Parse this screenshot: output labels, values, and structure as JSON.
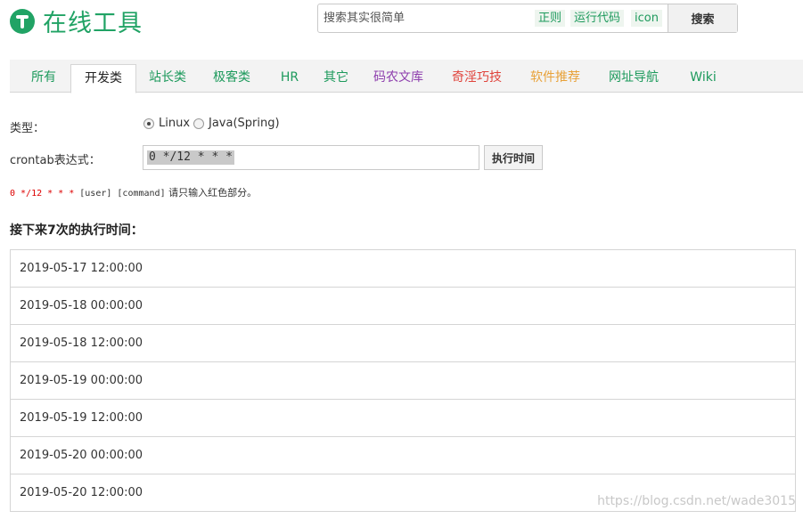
{
  "site": {
    "title": "在线工具"
  },
  "search": {
    "placeholder": "搜索其实很简单",
    "quick_links": [
      "正则",
      "运行代码",
      "icon"
    ],
    "button_label": "搜索"
  },
  "nav": {
    "active_index": 1,
    "items": [
      {
        "label": "所有",
        "color": "#1d9a5c"
      },
      {
        "label": "开发类",
        "color": "#222222"
      },
      {
        "label": "站长类",
        "color": "#1d9a5c"
      },
      {
        "label": "极客类",
        "color": "#1d9a5c"
      },
      {
        "label": "HR",
        "color": "#1d9a5c"
      },
      {
        "label": "其它",
        "color": "#1d9a5c"
      },
      {
        "label": "码农文库",
        "color": "#8e3fae"
      },
      {
        "label": "奇淫巧技",
        "color": "#e0443c"
      },
      {
        "label": "软件推荐",
        "color": "#e8a23a"
      },
      {
        "label": "网址导航",
        "color": "#1d9a5c"
      },
      {
        "label": "Wiki",
        "color": "#1d9a5c"
      }
    ]
  },
  "form": {
    "type_label": "类型：",
    "options": [
      {
        "label": "Linux",
        "checked": true
      },
      {
        "label": "Java(Spring)",
        "checked": false
      }
    ],
    "cron_label": "crontab表达式：",
    "cron_value": "0 */12 * * *",
    "exec_button": "执行时间"
  },
  "hint": {
    "red_part": "0 */12 * * *",
    "mono_part": " [user] [command]",
    "text": " 请只输入红色部分。"
  },
  "results": {
    "title": "接下来7次的执行时间：",
    "times": [
      "2019-05-17 12:00:00",
      "2019-05-18 00:00:00",
      "2019-05-18 12:00:00",
      "2019-05-19 00:00:00",
      "2019-05-19 12:00:00",
      "2019-05-20 00:00:00",
      "2019-05-20 12:00:00"
    ]
  },
  "watermark": "https://blog.csdn.net/wade3015"
}
